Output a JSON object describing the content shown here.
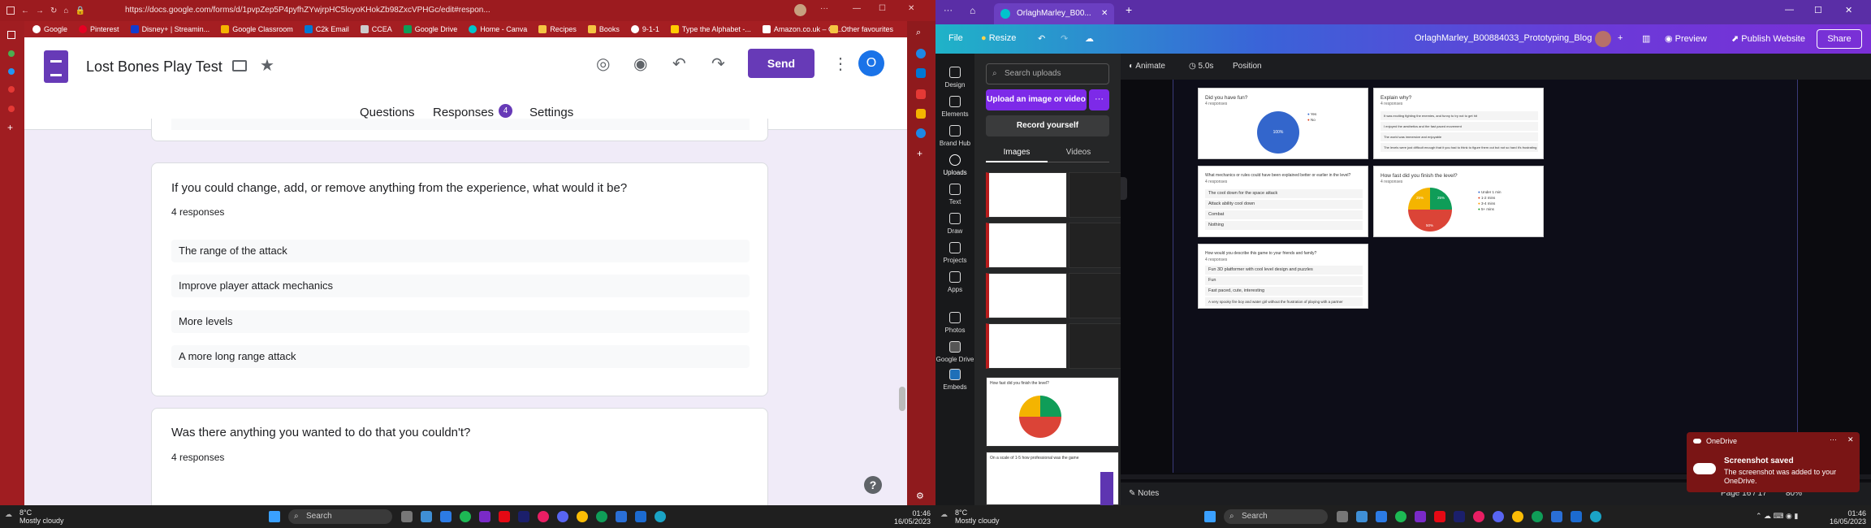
{
  "left_browser": {
    "url": "https://docs.google.com/forms/d/1pvpZep5P4pyfhZYwjrpHC5loyoKHokZb98ZxcVPHGc/edit#respon...",
    "favorites": [
      "Google",
      "Pinterest",
      "Disney+ | Streamin...",
      "Google Classroom",
      "C2k Email",
      "CCEA",
      "Google Drive",
      "Home - Canva",
      "Recipes",
      "Books",
      "9-1-1",
      "Type the Alphabet -...",
      "Amazon.co.uk – On..."
    ],
    "other_favourites": "Other favourites"
  },
  "forms": {
    "title": "Lost Bones Play Test",
    "send_label": "Send",
    "avatar_letter": "O",
    "tabs": {
      "questions": "Questions",
      "responses": "Responses",
      "settings": "Settings"
    },
    "response_count": "4",
    "card1": {
      "question": "If you could change, add, or remove anything from the experience, what would it be?",
      "count": "4 responses",
      "answers": [
        "The range of the attack",
        "Improve player attack mechanics",
        "More levels",
        "A more long range attack"
      ]
    },
    "card2": {
      "question": "Was there anything you wanted to do that you couldn't?",
      "count": "4 responses"
    },
    "help": "?"
  },
  "left_taskbar": {
    "temp": "8°C",
    "weather": "Mostly cloudy",
    "search": "Search",
    "time": "01:46",
    "date": "16/05/2023"
  },
  "canva": {
    "tab_title": "OrlaghMarley_B00...",
    "menu": {
      "file": "File",
      "resize": "Resize",
      "doc_title": "OrlaghMarley_B00884033_Prototyping_Blog",
      "preview": "Preview",
      "publish": "Publish Website",
      "share": "Share"
    },
    "nav": [
      "Design",
      "Elements",
      "Brand Hub",
      "Uploads",
      "Text",
      "Draw",
      "Projects",
      "Apps",
      "Photos",
      "Google Drive",
      "Embeds"
    ],
    "search_placeholder": "Search uploads",
    "upload_btn": "Upload an image or video",
    "more": "···",
    "record_btn": "Record yourself",
    "tab_images": "Images",
    "tab_videos": "Videos",
    "toolbar": {
      "animate": "Animate",
      "duration": "5.0s",
      "position": "Position"
    },
    "thumb_titles": {
      "fast": "How fast did you finish the level?",
      "scale": "On a scale of 1-5 how professional was the game"
    },
    "cards": {
      "fun": {
        "title": "Did you have fun?",
        "count": "4 responses",
        "pct": "100%",
        "legend": [
          "Yes",
          "No"
        ]
      },
      "why": {
        "title": "Explain why?",
        "count": "4 responses",
        "rows": [
          "It was exciting fighting the enemies, and funny to try not to get hit",
          "I enjoyed the aesthetics and the fast paced movement",
          "The world was immersive and enjoyable",
          "The levels were just difficult enough that it you had to think to figure them out but not so hard it's frustrating"
        ]
      },
      "mech": {
        "title": "What mechanics or rules could have been explained better or earlier in the level?",
        "count": "4 responses",
        "rows": [
          "The cool down for the space attack",
          "Attack ability cool down",
          "Combat",
          "Nothing"
        ]
      },
      "speed": {
        "title": "How fast did you finish the level?",
        "count": "4 responses",
        "legend": [
          "Under 1 min",
          "1-2 mins",
          "3-4 mins",
          "5+ mins"
        ],
        "labels": [
          "25%",
          "25%",
          "50%"
        ]
      },
      "describe": {
        "title": "How would you describe this game to your friends and family?",
        "count": "4 responses",
        "rows": [
          "Fun 3D platformer with cool level design and puzzles",
          "Fun",
          "Fast paced, cute, interesting",
          "A very spooky fire boy and water girl without the frustration of playing with a partner"
        ]
      }
    },
    "status": {
      "notes": "Notes",
      "page": "Page 16 / 17",
      "zoom": "80%"
    }
  },
  "toast": {
    "app": "OneDrive",
    "title": "Screenshot saved",
    "body": "The screenshot was added to your OneDrive."
  },
  "right_taskbar": {
    "temp": "8°C",
    "weather": "Mostly cloudy",
    "search": "Search",
    "time": "01:46",
    "date": "16/05/2023"
  },
  "colors": {
    "forms_purple": "#673ab7",
    "edge_red": "#9c1b1f",
    "canva_purple": "#7d2ae8"
  }
}
